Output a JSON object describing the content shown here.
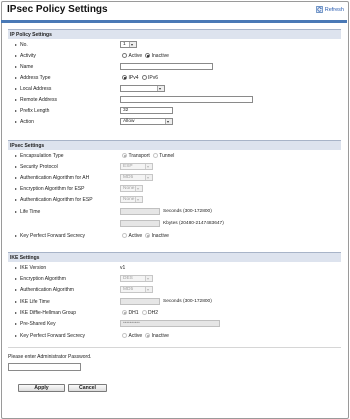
{
  "page": {
    "title": "IPsec Policy Settings",
    "refresh_label": "Refresh"
  },
  "ip_policy": {
    "heading": "IP Policy Settings",
    "no_label": "No.",
    "no_value": "1",
    "activity_label": "Activity",
    "active_label": "Active",
    "inactive_label": "Inactive",
    "activity_selected": "Inactive",
    "name_label": "Name",
    "name_value": "",
    "address_type_label": "Address Type",
    "ipv4_label": "IPv4",
    "ipv6_label": "IPv6",
    "address_type_selected": "IPv4",
    "local_address_label": "Local Address",
    "local_address_value": "",
    "remote_address_label": "Remote Address",
    "remote_address_value": "",
    "prefix_length_label": "Prefix Length",
    "prefix_length_value": "32",
    "action_label": "Action",
    "action_value": "Allow"
  },
  "ipsec": {
    "heading": "IPsec Settings",
    "encapsulation_label": "Encapsulation Type",
    "transport_label": "Transport",
    "tunnel_label": "Tunnel",
    "security_protocol_label": "Security Protocol",
    "security_protocol_value": "ESP",
    "auth_ah_label": "Authentication Algorithm for AH",
    "auth_ah_value": "MD5",
    "enc_esp_label": "Encryption Algorithm for ESP",
    "enc_esp_value": "None",
    "auth_esp_label": "Authentication Algorithm for ESP",
    "auth_esp_value": "None",
    "life_time_label": "Life Time",
    "life_time_seconds": "",
    "seconds_hint": "Seconds (300-172800)",
    "life_time_kbytes": "",
    "kbytes_hint": "Kbytes (20480-2147483647)",
    "pfs_label": "Key Perfect Forward Secrecy",
    "active_label": "Active",
    "inactive_label": "Inactive"
  },
  "ike": {
    "heading": "IKE Settings",
    "version_label": "IKE Version",
    "version_value": "v1",
    "enc_label": "Encryption Algorithm",
    "enc_value": "DES",
    "auth_label": "Authentication Algorithm",
    "auth_value": "MD5",
    "life_time_label": "IKE Life Time",
    "life_time_value": "",
    "seconds_hint": "Seconds (300-172800)",
    "dh_label": "IKE Diffie-Hellman Group",
    "dh1_label": "DH1",
    "dh2_label": "DH2",
    "psk_label": "Pre-Shared Key",
    "psk_value": "••••••••••",
    "pfs_label": "Key Perfect Forward Secrecy",
    "active_label": "Active",
    "inactive_label": "Inactive"
  },
  "admin": {
    "prompt": "Please enter Administrator Password.",
    "password_value": ""
  },
  "buttons": {
    "apply": "Apply",
    "cancel": "Cancel"
  }
}
